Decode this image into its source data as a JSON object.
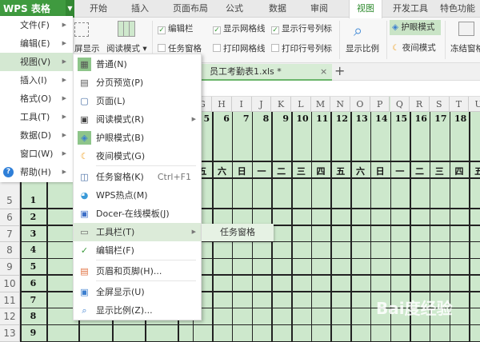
{
  "app": {
    "title": "WPS 表格"
  },
  "tabs": [
    {
      "label": "开始"
    },
    {
      "label": "插入"
    },
    {
      "label": "页面布局"
    },
    {
      "label": "公式"
    },
    {
      "label": "数据"
    },
    {
      "label": "审阅"
    },
    {
      "label": "视图",
      "active": true
    },
    {
      "label": "开发工具"
    },
    {
      "label": "特色功能"
    }
  ],
  "ribbon": {
    "fullscreen": "屏显示",
    "reading_mode": "阅读模式 ▾",
    "edit_bar": "编辑栏",
    "task_pane": "任务窗格",
    "show_gridlines": "显示网格线",
    "print_gridlines": "打印网格线",
    "show_headers": "显示行号列标",
    "print_headers": "打印行号列标",
    "zoom": "显示比例",
    "eye_mode": "护眼模式",
    "night_mode": "夜间模式",
    "freeze": "冻结窗格"
  },
  "document": {
    "tab": "员工考勤表1.xls *",
    "close": "×",
    "new": "+"
  },
  "main_menu": [
    {
      "label": "文件(F)"
    },
    {
      "label": "编辑(E)"
    },
    {
      "label": "视图(V)"
    },
    {
      "label": "插入(I)"
    },
    {
      "label": "格式(O)"
    },
    {
      "label": "工具(T)"
    },
    {
      "label": "数据(D)"
    },
    {
      "label": "窗口(W)"
    },
    {
      "label": "帮助(H)"
    }
  ],
  "view_menu": [
    {
      "label": "普通(N)"
    },
    {
      "label": "分页预览(P)"
    },
    {
      "label": "页面(L)"
    },
    {
      "label": "阅读模式(R)"
    },
    {
      "label": "护眼模式(B)"
    },
    {
      "label": "夜间模式(G)"
    },
    {
      "label": "任务窗格(K)",
      "shortcut": "Ctrl+F1"
    },
    {
      "label": "WPS热点(M)"
    },
    {
      "label": "Docer-在线模板(J)"
    },
    {
      "label": "工具栏(T)"
    },
    {
      "label": "编辑栏(F)"
    },
    {
      "label": "页眉和页脚(H)..."
    },
    {
      "label": "全屏显示(U)"
    },
    {
      "label": "显示比例(Z)..."
    }
  ],
  "toolbar_submenu": {
    "label": "任务窗格"
  },
  "sheet": {
    "columns": [
      "G",
      "H",
      "I",
      "J",
      "K",
      "L",
      "M",
      "N",
      "O",
      "P",
      "Q",
      "R",
      "S",
      "T",
      "U"
    ],
    "dates": [
      "5",
      "6",
      "7",
      "8",
      "9",
      "10",
      "11",
      "12",
      "13",
      "14",
      "15",
      "16",
      "17",
      "18",
      ""
    ],
    "weekdays": [
      "五",
      "六",
      "日",
      "一",
      "二",
      "三",
      "四",
      "五",
      "六",
      "日",
      "一",
      "二",
      "三",
      "四",
      "五"
    ],
    "row_numbers": [
      "5",
      "6",
      "7",
      "8",
      "9",
      "10",
      "11",
      "12",
      "13"
    ],
    "serials": [
      "1",
      "2",
      "3",
      "4",
      "5",
      "6",
      "7",
      "8",
      "9"
    ]
  },
  "watermark": "Bai度经验"
}
